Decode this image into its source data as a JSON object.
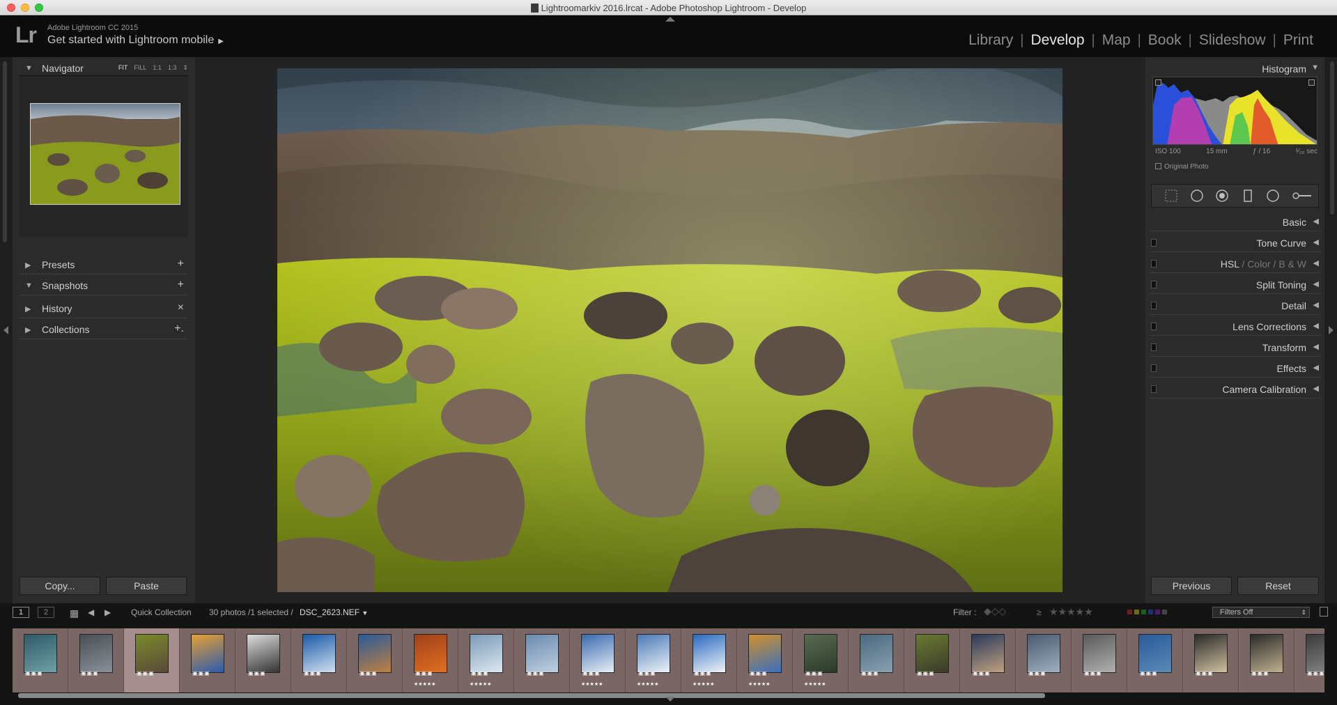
{
  "window": {
    "title": "Lightroomarkiv 2016.lrcat - Adobe Photoshop Lightroom - Develop"
  },
  "identity": {
    "logo": "Lr",
    "product": "Adobe Lightroom CC 2015",
    "mobile": "Get started with Lightroom mobile",
    "mobile_arrow": "▶"
  },
  "modules": [
    "Library",
    "Develop",
    "Map",
    "Book",
    "Slideshow",
    "Print"
  ],
  "module_active": "Develop",
  "left_panel": {
    "navigator": {
      "title": "Navigator",
      "zoom": [
        "FIT",
        "FILL",
        "1:1",
        "1:3"
      ]
    },
    "presets": {
      "label": "Presets",
      "action": "+"
    },
    "snapshots": {
      "label": "Snapshots",
      "action": "+"
    },
    "history": {
      "label": "History",
      "action": "×"
    },
    "collections": {
      "label": "Collections",
      "action": "+."
    },
    "copy_label": "Copy...",
    "paste_label": "Paste"
  },
  "right_panel": {
    "histogram": {
      "title": "Histogram",
      "iso": "ISO 100",
      "focal": "15 mm",
      "aperture": "ƒ / 16",
      "shutter": "¹⁄₂₀ sec",
      "original_photo": "Original Photo"
    },
    "sections": {
      "basic": "Basic",
      "tone_curve": "Tone Curve",
      "hsl": "HSL",
      "color": "Color",
      "bw": "B & W",
      "split_toning": "Split Toning",
      "detail": "Detail",
      "lens_corrections": "Lens Corrections",
      "transform": "Transform",
      "effects": "Effects",
      "camera_calibration": "Camera Calibration"
    },
    "previous_label": "Previous",
    "reset_label": "Reset"
  },
  "filmstrip_bar": {
    "page1": "1",
    "page2": "2",
    "source": "Quick Collection",
    "count": "30 photos /1 selected /",
    "filename": "DSC_2623.NEF",
    "filter_label": "Filter :",
    "filters_off": "Filters Off"
  },
  "filmstrip": {
    "thumbs": [
      {
        "stars": ""
      },
      {
        "stars": ""
      },
      {
        "stars": "",
        "selected": true
      },
      {
        "stars": ""
      },
      {
        "stars": ""
      },
      {
        "stars": ""
      },
      {
        "stars": ""
      },
      {
        "stars": "★★★★★"
      },
      {
        "stars": "★★★★★"
      },
      {
        "stars": ""
      },
      {
        "stars": "★★★★★"
      },
      {
        "stars": "★★★★★"
      },
      {
        "stars": "★★★★★"
      },
      {
        "stars": "★★★★★"
      },
      {
        "stars": "★★★★★"
      },
      {
        "stars": ""
      },
      {
        "stars": ""
      },
      {
        "stars": ""
      },
      {
        "stars": ""
      },
      {
        "stars": ""
      },
      {
        "stars": ""
      },
      {
        "stars": ""
      },
      {
        "stars": ""
      },
      {
        "stars": ""
      }
    ]
  },
  "colors": {
    "panel_bg": "#2b2b2b",
    "accent_text": "#e6e6e6",
    "filmstrip_bg": "#7a6665"
  }
}
